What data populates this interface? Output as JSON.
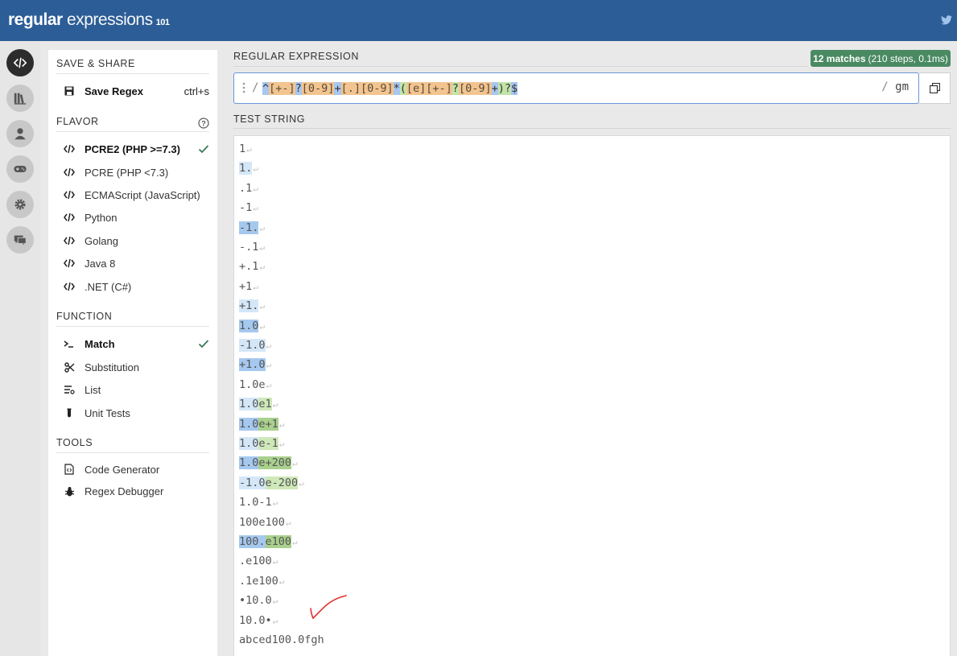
{
  "header": {
    "logo_part1": "regular",
    "logo_part2": " expressions",
    "logo_part3": "101",
    "twitter_icon": "twitter-icon"
  },
  "rail": {
    "icons": [
      "code-icon",
      "library-icon",
      "user-icon",
      "gamepad-icon",
      "gear-icon",
      "chat-icon"
    ]
  },
  "sidebar": {
    "save_share_title": "SAVE & SHARE",
    "save_label": "Save Regex",
    "save_shortcut": "ctrl+s",
    "flavor_title": "FLAVOR",
    "flavors": [
      "PCRE2 (PHP >=7.3)",
      "PCRE (PHP <7.3)",
      "ECMAScript (JavaScript)",
      "Python",
      "Golang",
      "Java 8",
      ".NET (C#)"
    ],
    "function_title": "FUNCTION",
    "functions": [
      "Match",
      "Substitution",
      "List",
      "Unit Tests"
    ],
    "tools_title": "TOOLS",
    "tools": [
      "Code Generator",
      "Regex Debugger"
    ]
  },
  "main": {
    "regex_label": "REGULAR EXPRESSION",
    "matches_bold": "12 matches",
    "matches_detail": "(210 steps, 0.1ms)",
    "regex_slash": "/",
    "regex_tokens": [
      {
        "text": "^",
        "cls": "tk-anchor"
      },
      {
        "text": "[+-]",
        "cls": "tk-set"
      },
      {
        "text": "?",
        "cls": "tk-q"
      },
      {
        "text": "[0-9]",
        "cls": "tk-set"
      },
      {
        "text": "+",
        "cls": "tk-q"
      },
      {
        "text": "[.]",
        "cls": "tk-set"
      },
      {
        "text": "[0-9]",
        "cls": "tk-set"
      },
      {
        "text": "*",
        "cls": "tk-q"
      },
      {
        "text": "(",
        "cls": "tk-group"
      },
      {
        "text": "[e]",
        "cls": "tk-set"
      },
      {
        "text": "[+-]",
        "cls": "tk-set"
      },
      {
        "text": "?",
        "cls": "tk-group"
      },
      {
        "text": "[0-9]",
        "cls": "tk-set"
      },
      {
        "text": "+",
        "cls": "tk-q"
      },
      {
        "text": ")",
        "cls": "tk-group"
      },
      {
        "text": "?",
        "cls": "tk-group"
      },
      {
        "text": "$",
        "cls": "tk-anchor"
      }
    ],
    "regex_flags_slash": "/",
    "regex_flags": "gm",
    "test_label": "TEST STRING",
    "test_lines": [
      {
        "parts": [
          [
            "1",
            ""
          ]
        ],
        "nl": true
      },
      {
        "parts": [
          [
            "1.",
            "m2"
          ]
        ],
        "nl": true
      },
      {
        "parts": [
          [
            ".1",
            ""
          ]
        ],
        "nl": true
      },
      {
        "parts": [
          [
            "-1",
            ""
          ]
        ],
        "nl": true
      },
      {
        "parts": [
          [
            "-1.",
            "m1"
          ]
        ],
        "nl": true
      },
      {
        "parts": [
          [
            "-.1",
            ""
          ]
        ],
        "nl": true
      },
      {
        "parts": [
          [
            "+.1",
            ""
          ]
        ],
        "nl": true
      },
      {
        "parts": [
          [
            "+1",
            ""
          ]
        ],
        "nl": true
      },
      {
        "parts": [
          [
            "+1.",
            "m2"
          ]
        ],
        "nl": true
      },
      {
        "parts": [
          [
            "1.0",
            "m1"
          ]
        ],
        "nl": true
      },
      {
        "parts": [
          [
            "-1.0",
            "m2"
          ]
        ],
        "nl": true
      },
      {
        "parts": [
          [
            "+1.0",
            "m1"
          ]
        ],
        "nl": true
      },
      {
        "parts": [
          [
            "1.0e",
            ""
          ]
        ],
        "nl": true
      },
      {
        "parts": [
          [
            "1.0",
            "m2"
          ],
          [
            "e1",
            "g2"
          ]
        ],
        "nl": true
      },
      {
        "parts": [
          [
            "1.0",
            "m1"
          ],
          [
            "e+1",
            "g1"
          ]
        ],
        "nl": true
      },
      {
        "parts": [
          [
            "1.0",
            "m2"
          ],
          [
            "e-1",
            "g2"
          ]
        ],
        "nl": true
      },
      {
        "parts": [
          [
            "1.0",
            "m1"
          ],
          [
            "e+200",
            "g1"
          ]
        ],
        "nl": true
      },
      {
        "parts": [
          [
            "-1.0",
            "m2"
          ],
          [
            "e-200",
            "g2"
          ]
        ],
        "nl": true
      },
      {
        "parts": [
          [
            "1.0-1",
            ""
          ]
        ],
        "nl": true
      },
      {
        "parts": [
          [
            "100e100",
            ""
          ]
        ],
        "nl": true
      },
      {
        "parts": [
          [
            "100.",
            "m1"
          ],
          [
            "e100",
            "g1"
          ]
        ],
        "nl": true
      },
      {
        "parts": [
          [
            ".e100",
            ""
          ]
        ],
        "nl": true
      },
      {
        "parts": [
          [
            ".1e100",
            ""
          ]
        ],
        "nl": true
      },
      {
        "parts": [
          [
            "•10.0",
            ""
          ]
        ],
        "nl": true
      },
      {
        "parts": [
          [
            "10.0•",
            ""
          ]
        ],
        "nl": true
      },
      {
        "parts": [
          [
            "abced100.0fgh",
            ""
          ]
        ],
        "nl": false
      }
    ]
  }
}
